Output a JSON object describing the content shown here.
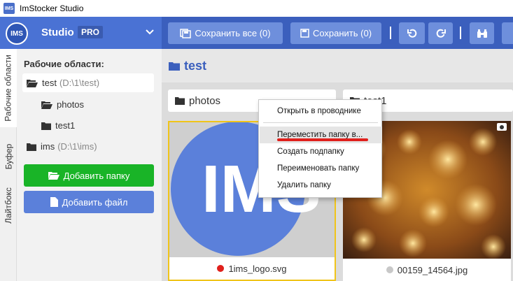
{
  "window": {
    "title": "ImStocker Studio",
    "app_icon": "IMS"
  },
  "header": {
    "logo_text": "IMS",
    "studio_label": "Studio",
    "pro_badge": "PRO",
    "toolbar": {
      "save_all_label": "Сохранить все (0)",
      "save_label": "Сохранить (0)"
    },
    "accent_color": "#4a72d4"
  },
  "vertical_tabs": [
    "Рабочие области",
    "Буфер",
    "Лайтбокс"
  ],
  "sidebar": {
    "title": "Рабочие области:",
    "items": [
      {
        "name": "test",
        "path": "(D:\\1\\test)"
      },
      {
        "name": "photos",
        "path": ""
      },
      {
        "name": "test1",
        "path": ""
      },
      {
        "name": "ims",
        "path": "(D:\\1\\ims)"
      }
    ],
    "add_folder_label": "Добавить папку",
    "add_file_label": "Добавить файл"
  },
  "main": {
    "title": "test",
    "folders": [
      {
        "name": "photos"
      },
      {
        "name": "test1"
      }
    ],
    "images": [
      {
        "filename": "1ims_logo.svg",
        "status_color": "#e0201c",
        "thumb_text": "IMS"
      },
      {
        "filename": "00159_14564.jpg",
        "status_color": "#c8c8c8"
      }
    ]
  },
  "context_menu": {
    "items": [
      "Открыть в проводнике",
      "Переместить папку в...",
      "Создать подпапку",
      "Переименовать папку",
      "Удалить папку"
    ]
  }
}
